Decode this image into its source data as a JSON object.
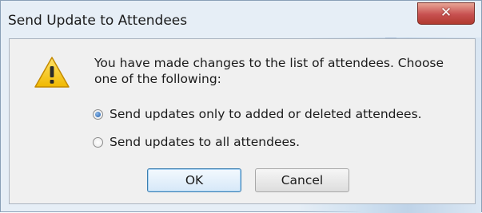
{
  "window": {
    "title": "Send Update to Attendees",
    "close_icon": "close-icon",
    "close_glyph": "✕"
  },
  "message": {
    "icon": "warning-icon",
    "text": "You have made changes to the list of attendees. Choose one of the following:"
  },
  "options": [
    {
      "label": "Send updates only to added or deleted attendees.",
      "selected": true
    },
    {
      "label": "Send updates to all attendees.",
      "selected": false
    }
  ],
  "buttons": {
    "ok_label": "OK",
    "cancel_label": "Cancel"
  },
  "colors": {
    "accent": "#3c7fb1",
    "close_button": "#c75050",
    "warning": "#f2c200"
  }
}
